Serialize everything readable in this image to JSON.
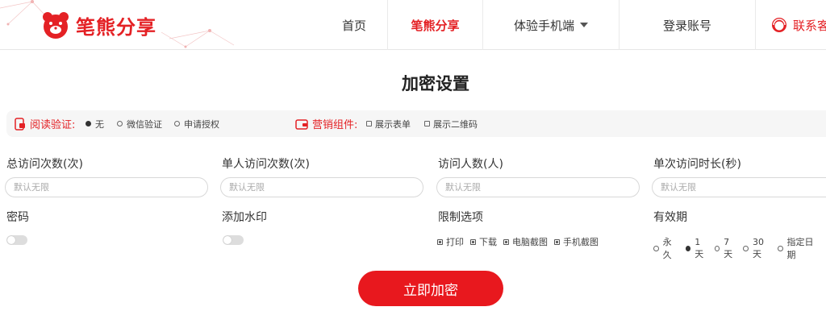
{
  "brand": {
    "name": "笔熊分享",
    "color": "#e42125"
  },
  "nav": {
    "home": "首页",
    "share": "笔熊分享",
    "mobile": "体验手机端",
    "login": "登录账号",
    "contact": "联系客"
  },
  "page_title": "加密设置",
  "read_verify": {
    "label": "阅读验证:",
    "icon": "phone-lock-icon",
    "options": [
      "无",
      "微信验证",
      "申请授权"
    ],
    "selected": "无"
  },
  "marketing": {
    "label": "营销组件:",
    "icon": "wallet-icon",
    "options": [
      "展示表单",
      "展示二维码"
    ]
  },
  "fields": {
    "total_visits": {
      "label": "总访问次数(次)",
      "placeholder": "默认无限"
    },
    "single_visits": {
      "label": "单人访问次数(次)",
      "placeholder": "默认无限"
    },
    "visitors": {
      "label": "访问人数(人)",
      "placeholder": "默认无限"
    },
    "duration": {
      "label": "单次访问时长(秒)",
      "placeholder": "默认无限"
    }
  },
  "password": {
    "label": "密码"
  },
  "watermark": {
    "label": "添加水印"
  },
  "restrictions": {
    "label": "限制选项",
    "options": [
      "打印",
      "下载",
      "电脑截图",
      "手机截图"
    ]
  },
  "validity": {
    "label": "有效期",
    "options": [
      "永久",
      "1天",
      "7天",
      "30天",
      "指定日期"
    ],
    "selected": "1天"
  },
  "submit_label": "立即加密"
}
